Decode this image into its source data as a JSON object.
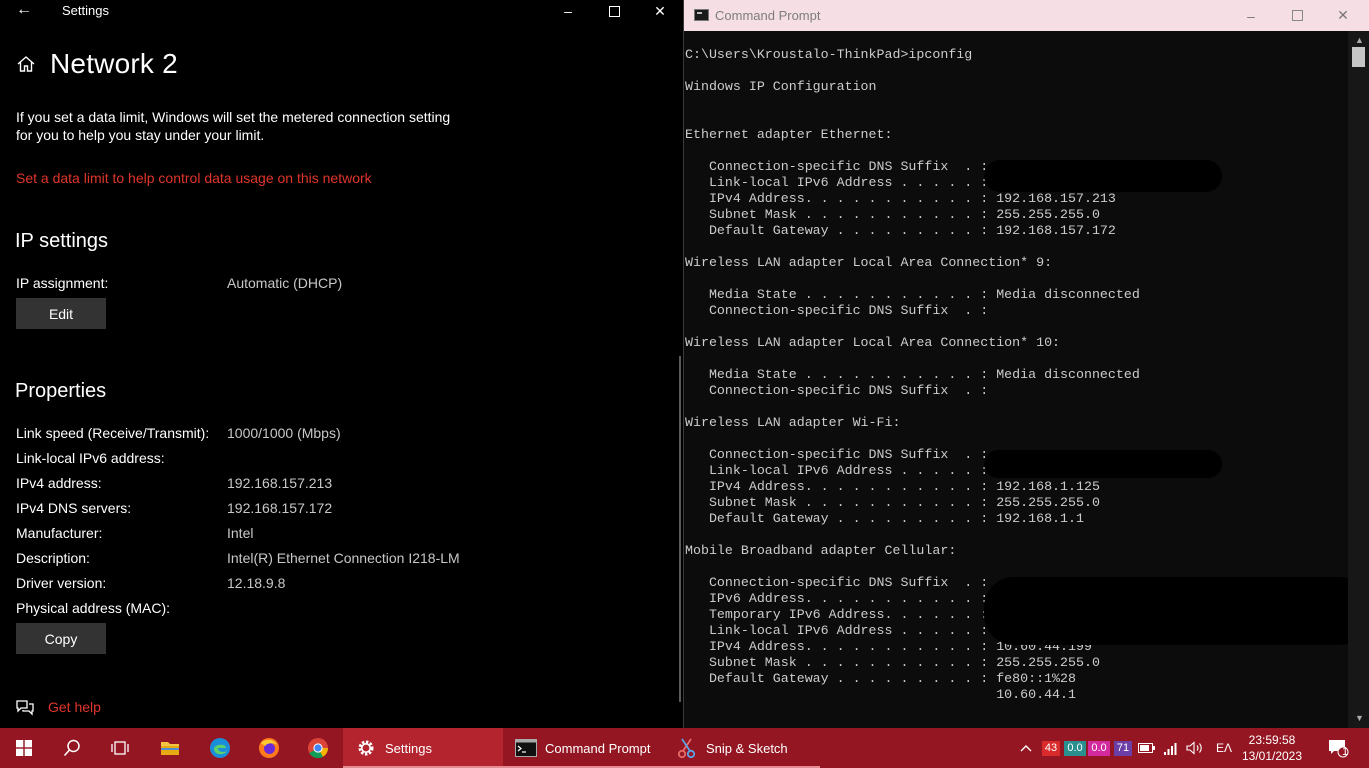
{
  "settings": {
    "window_title": "Settings",
    "page_title": "Network 2",
    "data_limit_text": "If you set a data limit, Windows will set the metered connection setting for you to help you stay under your limit.",
    "data_limit_link": "Set a data limit to help control data usage on this network",
    "ip_settings": {
      "heading": "IP settings",
      "assignment_label": "IP assignment:",
      "assignment_value": "Automatic (DHCP)",
      "edit_button": "Edit"
    },
    "properties": {
      "heading": "Properties",
      "rows": [
        {
          "label": "Link speed (Receive/Transmit):",
          "value": "1000/1000 (Mbps)"
        },
        {
          "label": "Link-local IPv6 address:",
          "value": ""
        },
        {
          "label": "IPv4 address:",
          "value": "192.168.157.213"
        },
        {
          "label": "IPv4 DNS servers:",
          "value": "192.168.157.172"
        },
        {
          "label": "Manufacturer:",
          "value": "Intel"
        },
        {
          "label": "Description:",
          "value": "Intel(R) Ethernet Connection I218-LM"
        },
        {
          "label": "Driver version:",
          "value": "12.18.9.8"
        },
        {
          "label": "Physical address (MAC):",
          "value": ""
        }
      ],
      "copy_button": "Copy"
    },
    "get_help": "Get help"
  },
  "cmd": {
    "window_title": "Command Prompt",
    "output": "C:\\Users\\Kroustalo-ThinkPad>ipconfig\n\nWindows IP Configuration\n\n\nEthernet adapter Ethernet:\n\n   Connection-specific DNS Suffix  . :\n   Link-local IPv6 Address . . . . . :\n   IPv4 Address. . . . . . . . . . . : 192.168.157.213\n   Subnet Mask . . . . . . . . . . . : 255.255.255.0\n   Default Gateway . . . . . . . . . : 192.168.157.172\n\nWireless LAN adapter Local Area Connection* 9:\n\n   Media State . . . . . . . . . . . : Media disconnected\n   Connection-specific DNS Suffix  . :\n\nWireless LAN adapter Local Area Connection* 10:\n\n   Media State . . . . . . . . . . . : Media disconnected\n   Connection-specific DNS Suffix  . :\n\nWireless LAN adapter Wi-Fi:\n\n   Connection-specific DNS Suffix  . :\n   Link-local IPv6 Address . . . . . :\n   IPv4 Address. . . . . . . . . . . : 192.168.1.125\n   Subnet Mask . . . . . . . . . . . : 255.255.255.0\n   Default Gateway . . . . . . . . . : 192.168.1.1\n\nMobile Broadband adapter Cellular:\n\n   Connection-specific DNS Suffix  . :\n   IPv6 Address. . . . . . . . . . . :\n   Temporary IPv6 Address. . . . . . :\n   Link-local IPv6 Address . . . . . :\n   IPv4 Address. . . . . . . . . . . : 10.60.44.199\n   Subnet Mask . . . . . . . . . . . : 255.255.255.0\n   Default Gateway . . . . . . . . . : fe80::1%28\n                                       10.60.44.1"
  },
  "taskbar": {
    "apps": [
      {
        "label": "Settings",
        "icon": "gear-icon"
      },
      {
        "label": "Command Prompt",
        "icon": "cmd-icon"
      },
      {
        "label": "Snip & Sketch",
        "icon": "snip-sketch-icon"
      }
    ],
    "tray": {
      "badge_red": "43",
      "badge_teal": "0.0",
      "badge_pink": "0.0",
      "badge_purple": "71",
      "language": "ΕΛ",
      "time": "23:59:58",
      "date": "13/01/2023",
      "notifications": "1"
    }
  },
  "colors": {
    "accent": "#931622",
    "link_red": "#e0352b",
    "button_gray": "#333333",
    "cmd_titlebar": "#f6dfe4"
  }
}
